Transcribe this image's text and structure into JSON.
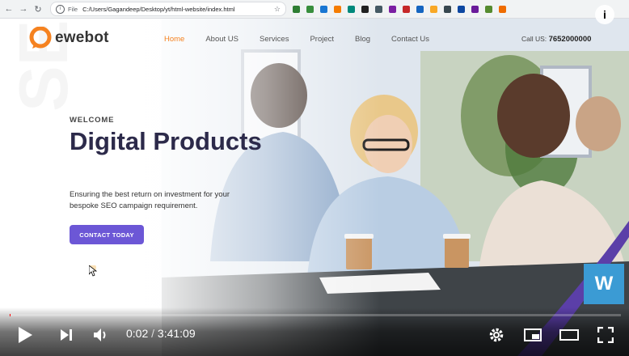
{
  "browser": {
    "file_label": "File",
    "url": "C:/Users/Gagandeep/Desktop/yt/html-website/index.html",
    "extension_colors": [
      "#2e7d32",
      "#388e3c",
      "#1976d2",
      "#f57c00",
      "#00897b",
      "#212121",
      "#455a64",
      "#7b1fa2",
      "#c62828",
      "#1565c0",
      "#f9a825",
      "#37474f",
      "#0d47a1",
      "#6a1b9a",
      "#558b2f",
      "#ef6c00"
    ]
  },
  "site": {
    "logo_text": "ewebot",
    "brand_color": "#f58220",
    "nav": [
      {
        "label": "Home",
        "active": true
      },
      {
        "label": "About US",
        "active": false
      },
      {
        "label": "Services",
        "active": false
      },
      {
        "label": "Project",
        "active": false
      },
      {
        "label": "Blog",
        "active": false
      },
      {
        "label": "Contact Us",
        "active": false
      }
    ],
    "call_label": "Call US:",
    "phone": "7652000000",
    "welcome": "WELCOME",
    "headline": "Digital Products",
    "tagline": "Ensuring the best return on investment for your bespoke SEO campaign requirement.",
    "cta_label": "CONTACT TODAY",
    "cta_color": "#6c57d6",
    "watermark": "SEO"
  },
  "player": {
    "info_icon": "i",
    "badge": "W",
    "current_time": "0:02",
    "separator": "/",
    "duration": "3:41:09",
    "progress_percent": 0.1
  }
}
